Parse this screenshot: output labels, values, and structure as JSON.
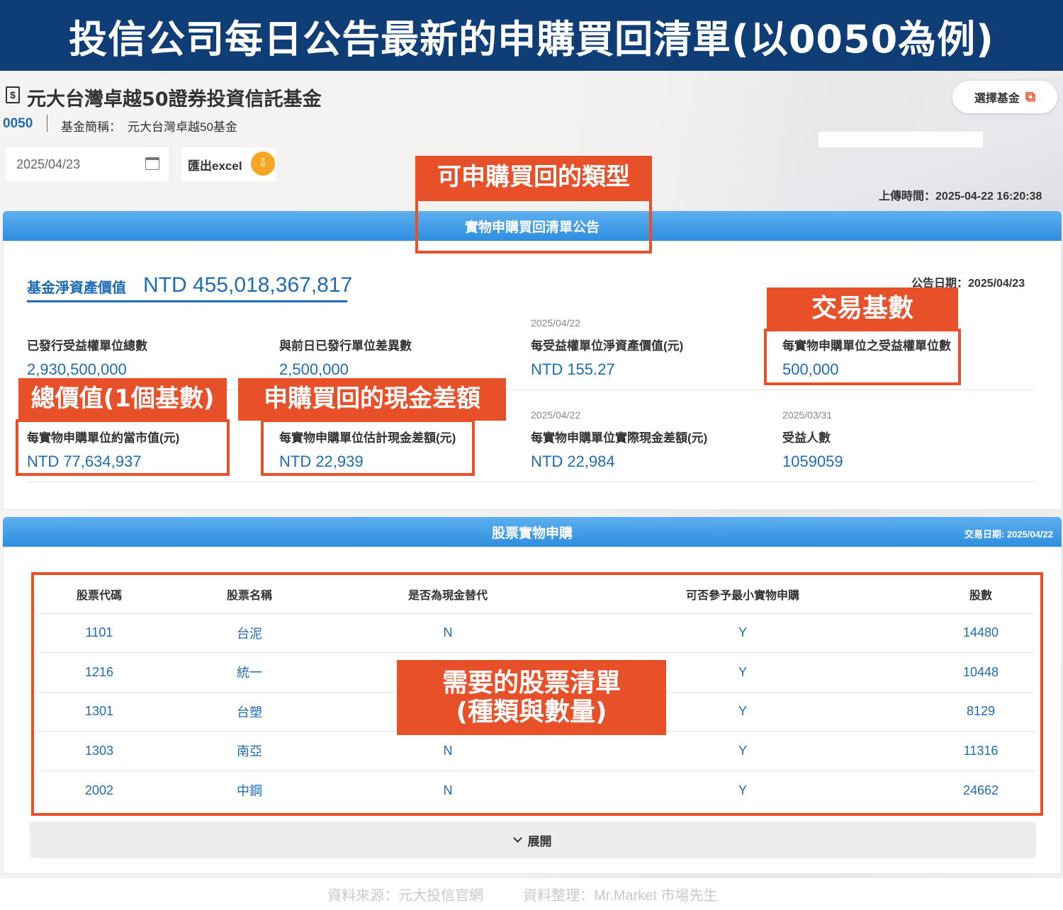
{
  "banner": {
    "title": "投信公司每日公告最新的申購買回清單(以0050為例)"
  },
  "fund": {
    "title": "元大台灣卓越50證券投資信託基金",
    "code": "0050",
    "short_name_label": "基金簡稱：",
    "short_name": "元大台灣卓越50基金",
    "select_button": "選擇基金"
  },
  "toolbar": {
    "date": "2025/04/23",
    "export_label": "匯出excel",
    "upload_time_label": "上傳時間：",
    "upload_time": "2025-04-22 16:20:38"
  },
  "section1": {
    "title": "實物申購買回清單公告",
    "nav_label": "基金淨資產價值",
    "nav_value": "NTD 455,018,367,817",
    "announce_label": "公告日期：",
    "announce_date": "2025/04/23",
    "metrics_row1": [
      {
        "date": "",
        "label": "已發行受益權單位總數",
        "value": "2,930,500,000"
      },
      {
        "date": "",
        "label": "與前日已發行單位差異數",
        "value": "2,500,000"
      },
      {
        "date": "2025/04/22",
        "label": "每受益權單位淨資產價值(元)",
        "value": "NTD 155.27"
      },
      {
        "date": "",
        "label": "每實物申購單位之受益權單位數",
        "value": "500,000"
      }
    ],
    "metrics_row2": [
      {
        "date": "",
        "label": "每實物申購單位約當市值(元)",
        "value": "NTD 77,634,937"
      },
      {
        "date": "",
        "label": "每實物申購單位估計現金差額(元)",
        "value": "NTD 22,939"
      },
      {
        "date": "2025/04/22",
        "label": "每實物申購單位實際現金差額(元)",
        "value": "NTD 22,984"
      },
      {
        "date": "2025/03/31",
        "label": "受益人數",
        "value": "1059059"
      }
    ]
  },
  "section2": {
    "title": "股票實物申購",
    "trade_date": "交易日期: 2025/04/22",
    "columns": [
      "股票代碼",
      "股票名稱",
      "是否為現金替代",
      "可否參予最小實物申購",
      "股數"
    ],
    "rows": [
      [
        "1101",
        "台泥",
        "N",
        "Y",
        "14480"
      ],
      [
        "1216",
        "統一",
        "",
        "Y",
        "10448"
      ],
      [
        "1301",
        "台塑",
        "",
        "Y",
        "8129"
      ],
      [
        "1303",
        "南亞",
        "N",
        "Y",
        "11316"
      ],
      [
        "2002",
        "中鋼",
        "N",
        "Y",
        "24662"
      ]
    ],
    "expand_label": "展開"
  },
  "callouts": {
    "type": "可申購買回的類型",
    "units": "交易基數",
    "total_value": "總價值(1個基數)",
    "cash_diff": "申購買回的現金差額",
    "stock_list_line1": "需要的股票清單",
    "stock_list_line2": "(種類與數量)"
  },
  "footer": {
    "source": "資料來源：元大投信官網",
    "compiled": "資料整理：Mr.Market 市場先生"
  },
  "colors": {
    "accent": "#e8502a",
    "banner": "#0f3d75",
    "link_blue": "#1e6bb8",
    "section_bar": "#3a96e4"
  }
}
